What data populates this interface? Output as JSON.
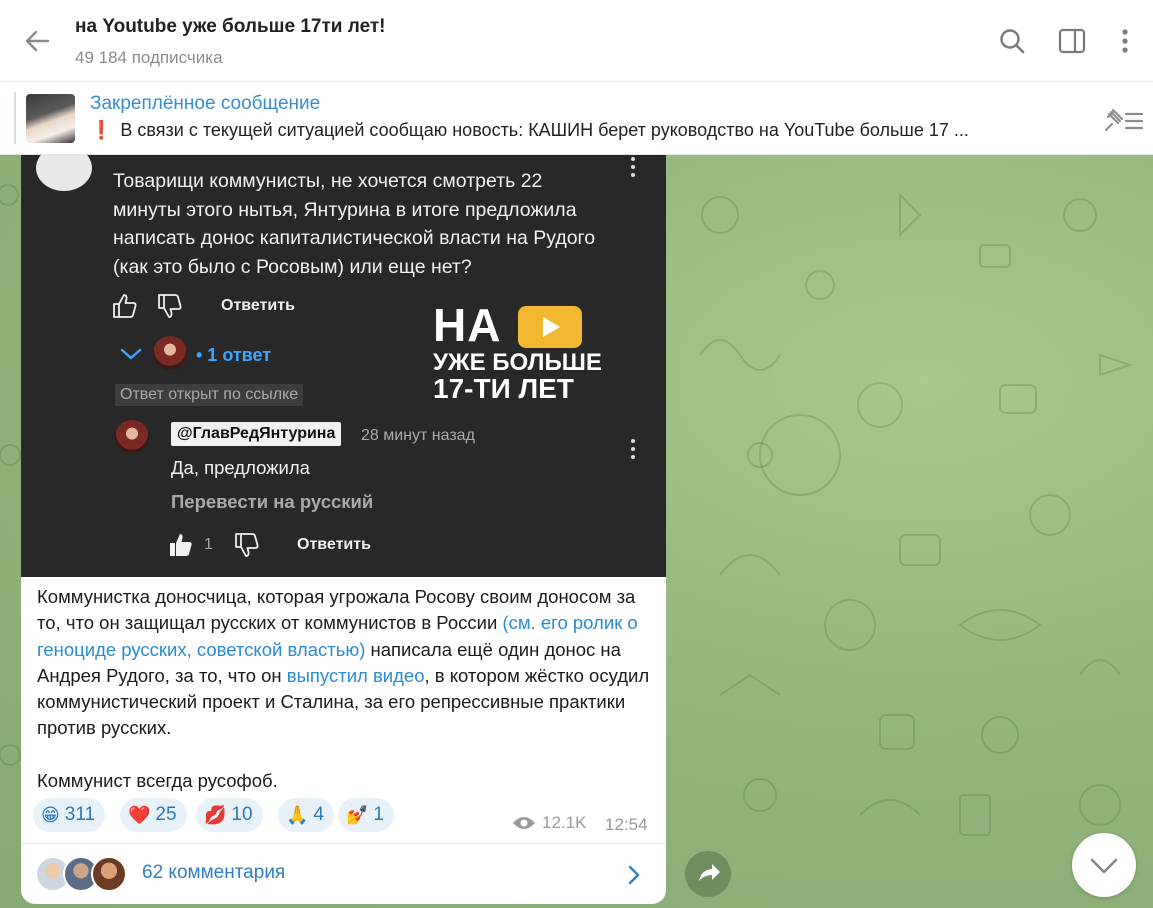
{
  "header": {
    "title": "на Youtube уже больше 17ти лет!",
    "subscribers": "49 184 подписчика"
  },
  "pinned": {
    "title": "Закреплённое сообщение",
    "text": "В связи с текущей ситуацией сообщаю новость:  КАШИН берет руководство на YouTube больше 17 ..."
  },
  "media": {
    "comment": "Товарищи коммунисты, не хочется смотреть 22 минуты этого нытья, Янтурина в итоге предложила написать донос капиталистической власти на Рудого (как это было с Росовым) или еще нет?",
    "reply_button": "Ответить",
    "replies": "• 1 ответ",
    "opened_badge": "Ответ открыт по ссылке",
    "reply_handle": "@ГлавРедЯнтурина",
    "reply_time": "28 минут назад",
    "reply_text": "Да, предложила",
    "translate": "Перевести на русский",
    "like_count": "1",
    "reply_button_2": "Ответить",
    "logo": {
      "line1": "НА",
      "line2": "УЖЕ БОЛЬШЕ",
      "line3": "17-ТИ ЛЕТ"
    }
  },
  "caption": {
    "part1": "Коммунистка доносчица, которая угрожала Росову своим доносом за то, что он защищал русских от коммунистов в России ",
    "link1": "(см. его ролик о геноциде русских, советской властью)",
    "part2": " написала ещё один донос на Андрея Рудого, за то, что он ",
    "link2": "выпустил видео",
    "part3": ", в котором жёстко осудил коммунистический проект и Сталина, за его репрессивные практики против русских.",
    "part4": "Коммунист всегда русофоб."
  },
  "reactions": [
    {
      "emoji": "😁",
      "count": "311"
    },
    {
      "emoji": "❤️",
      "count": "25"
    },
    {
      "emoji": "💋",
      "count": "10"
    },
    {
      "emoji": "🙏",
      "count": "4"
    },
    {
      "emoji": "💅",
      "count": "1"
    }
  ],
  "meta": {
    "views": "12.1K",
    "time": "12:54"
  },
  "comments": {
    "label": "62 комментария"
  },
  "colors": {
    "accent": "#3a8cd0",
    "chat_bg": "#93b67c",
    "yt_bg": "#282828",
    "yt_logo": "#f2b730"
  }
}
